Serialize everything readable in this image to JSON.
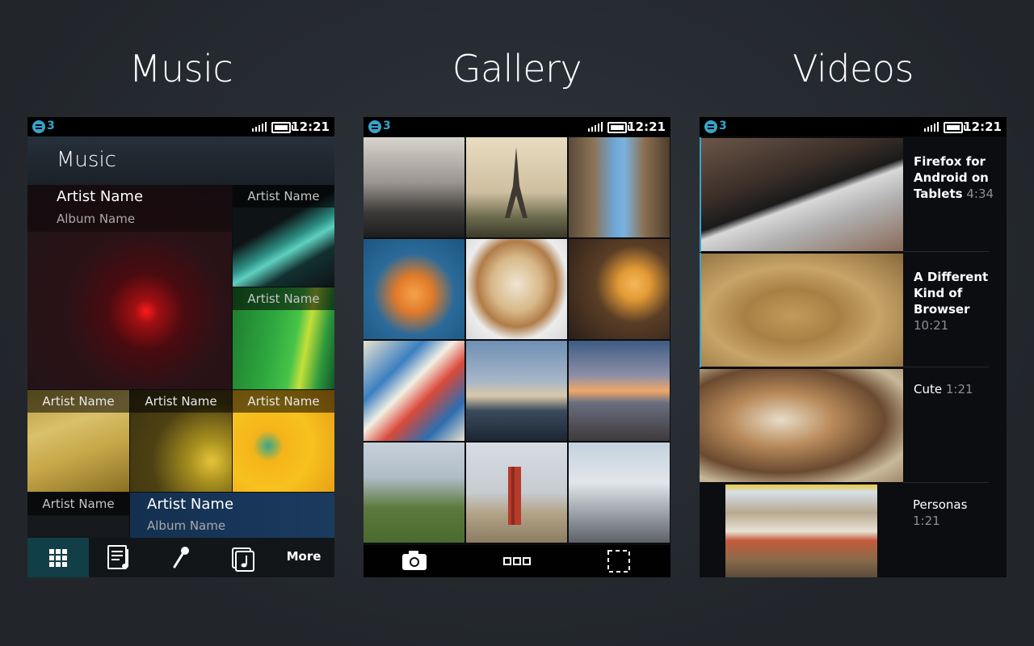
{
  "sections": {
    "music": "Music",
    "gallery": "Gallery",
    "videos": "Videos"
  },
  "status_bar": {
    "notification_count": "3",
    "time": "12:21",
    "icons": [
      "notification-icon",
      "signal-icon",
      "battery-icon"
    ]
  },
  "music": {
    "header_title": "Music",
    "featured": {
      "artist": "Artist Name",
      "album": "Album Name"
    },
    "tiles": [
      {
        "artist": "Artist Name"
      },
      {
        "artist": "Artist Name"
      },
      {
        "artist": "Artist Name"
      },
      {
        "artist": "Artist Name"
      },
      {
        "artist": "Artist Name"
      },
      {
        "artist": "Artist Name"
      }
    ],
    "now_playing": {
      "artist": "Artist Name",
      "album": "Album Name"
    },
    "toolbar": {
      "more_label": "More",
      "icons": [
        "grid-icon",
        "playlist-icon",
        "microphone-icon",
        "albums-icon"
      ]
    }
  },
  "gallery": {
    "toolbar_icons": [
      "camera-icon",
      "thumbnail-view-icon",
      "fullscreen-select-icon"
    ]
  },
  "videos": {
    "items": [
      {
        "title": "Firefox for Android on Tablets",
        "duration": "4:34"
      },
      {
        "title": "A Different Kind of Browser",
        "duration": "10:21"
      },
      {
        "title": "Cute",
        "duration": "1:21"
      },
      {
        "title": "Personas",
        "duration": "1:21"
      }
    ]
  },
  "colors": {
    "background": "#262b31",
    "accent": "#3aa3c9",
    "active_tool": "#123e47"
  }
}
